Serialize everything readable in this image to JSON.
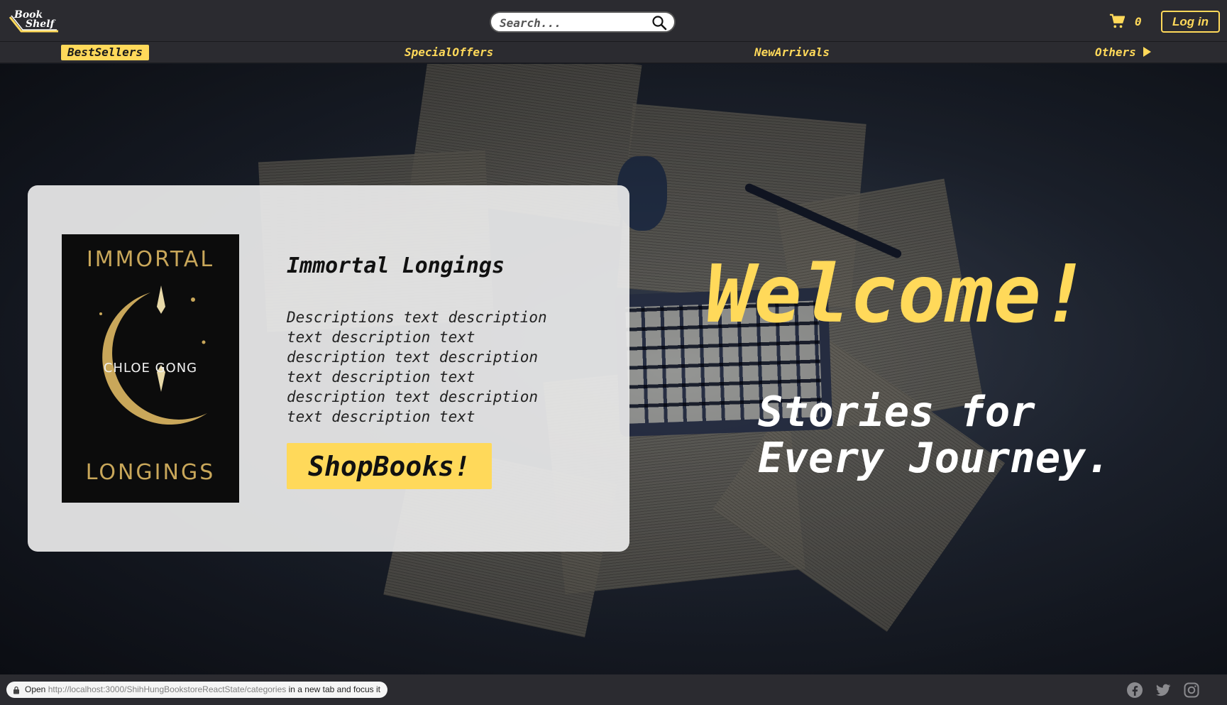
{
  "header": {
    "logo_line1": "Book",
    "logo_line2": "Shelf",
    "search_placeholder": "Search...",
    "cart_count": "0",
    "login_label": "Log in"
  },
  "nav": {
    "items": [
      {
        "label": "BestSellers",
        "active": true
      },
      {
        "label": "SpecialOffers",
        "active": false
      },
      {
        "label": "NewArrivals",
        "active": false
      },
      {
        "label": "Others",
        "active": false
      }
    ]
  },
  "featured": {
    "cover_title_top": "IMMORTAL",
    "cover_author": "CHLOE GONG",
    "cover_title_bottom": "LONGINGS",
    "title": "Immortal Longings",
    "description": "Descriptions text description text description text description text description text description text description text description text description text",
    "button_label": "ShopBooks!"
  },
  "hero": {
    "welcome": "Welcome!",
    "tagline_line1": "Stories for",
    "tagline_line2": "Every Journey."
  },
  "statusbar": {
    "prefix": "Open",
    "url": "http://localhost:3000/ShihHungBookstoreReactState/categories",
    "suffix": "in a new tab and focus it"
  },
  "social": [
    "facebook-icon",
    "twitter-icon",
    "instagram-icon"
  ],
  "colors": {
    "accent": "#ffd95a",
    "header_bg": "#2b2b30",
    "card_bg": "#ebebeb"
  }
}
